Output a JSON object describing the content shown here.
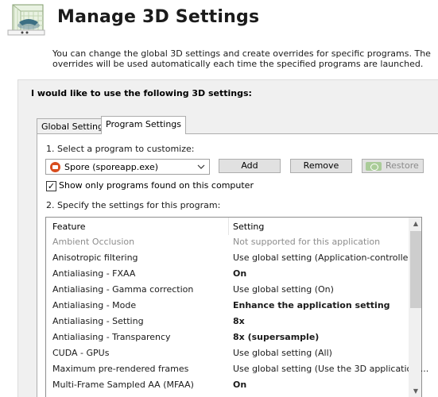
{
  "header": {
    "title": "Manage 3D Settings",
    "logo_icon": "nvidia-3d-settings-icon"
  },
  "description": "You can change the global 3D settings and create overrides for specific programs. The overrides will be used automatically each time the specified programs are launched.",
  "panel": {
    "heading": "I would like to use the following 3D settings:",
    "tabs": [
      {
        "label": "Global Settings",
        "active": false
      },
      {
        "label": "Program Settings",
        "active": true
      }
    ]
  },
  "program_settings": {
    "step1_label": "1. Select a program to customize:",
    "selected_program": "Spore (sporeapp.exe)",
    "program_icon": "spore-icon",
    "add_label": "Add",
    "remove_label": "Remove",
    "restore_label": "Restore",
    "restore_icon": "nvidia-logo-icon",
    "checkbox_checked": true,
    "checkbox_mark": "✓",
    "checkbox_label": "Show only programs found on this computer",
    "step2_label": "2. Specify the settings for this program:"
  },
  "settings_table": {
    "columns": [
      "Feature",
      "Setting"
    ],
    "rows": [
      {
        "feature": "Ambient Occlusion",
        "setting": "Not supported for this application",
        "disabled": true,
        "bold": false
      },
      {
        "feature": "Anisotropic filtering",
        "setting": "Use global setting (Application-controlled)",
        "disabled": false,
        "bold": false
      },
      {
        "feature": "Antialiasing - FXAA",
        "setting": "On",
        "disabled": false,
        "bold": true
      },
      {
        "feature": "Antialiasing - Gamma correction",
        "setting": "Use global setting (On)",
        "disabled": false,
        "bold": false
      },
      {
        "feature": "Antialiasing - Mode",
        "setting": "Enhance the application setting",
        "disabled": false,
        "bold": true
      },
      {
        "feature": "Antialiasing - Setting",
        "setting": "8x",
        "disabled": false,
        "bold": true
      },
      {
        "feature": "Antialiasing - Transparency",
        "setting": "8x (supersample)",
        "disabled": false,
        "bold": true
      },
      {
        "feature": "CUDA - GPUs",
        "setting": "Use global setting (All)",
        "disabled": false,
        "bold": false
      },
      {
        "feature": "Maximum pre-rendered frames",
        "setting": "Use global setting (Use the 3D application ...",
        "disabled": false,
        "bold": false
      },
      {
        "feature": "Multi-Frame Sampled AA (MFAA)",
        "setting": "On",
        "disabled": false,
        "bold": true
      }
    ]
  }
}
